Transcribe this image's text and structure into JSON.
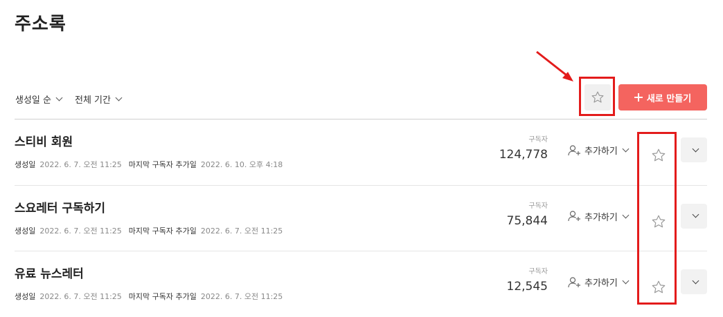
{
  "page": {
    "title": "주소록"
  },
  "toolbar": {
    "sort_label": "생성일 순",
    "period_label": "전체 기간",
    "new_button_label": "새로 만들기",
    "favorite_filter_icon": "star-outline-icon"
  },
  "list": {
    "subscriber_header": "구독자",
    "created_label": "생성일",
    "last_added_label": "마지막 구독자 추가일",
    "add_button_label": "추가하기",
    "items": [
      {
        "name": "스티비 회원",
        "created": "2022. 6. 7. 오전 11:25",
        "last_added": "2022. 6. 10. 오후 4:18",
        "subscribers": "124,778"
      },
      {
        "name": "스요레터 구독하기",
        "created": "2022. 6. 7. 오전 11:25",
        "last_added": "2022. 6. 7. 오전 11:25",
        "subscribers": "75,844"
      },
      {
        "name": "유료 뉴스레터",
        "created": "2022. 6. 7. 오전 11:25",
        "last_added": "2022. 6. 7. 오전 11:25",
        "subscribers": "12,545"
      }
    ]
  },
  "colors": {
    "accent": "#f4645f",
    "highlight": "#e31b1b",
    "divider": "#e5e5e5"
  }
}
